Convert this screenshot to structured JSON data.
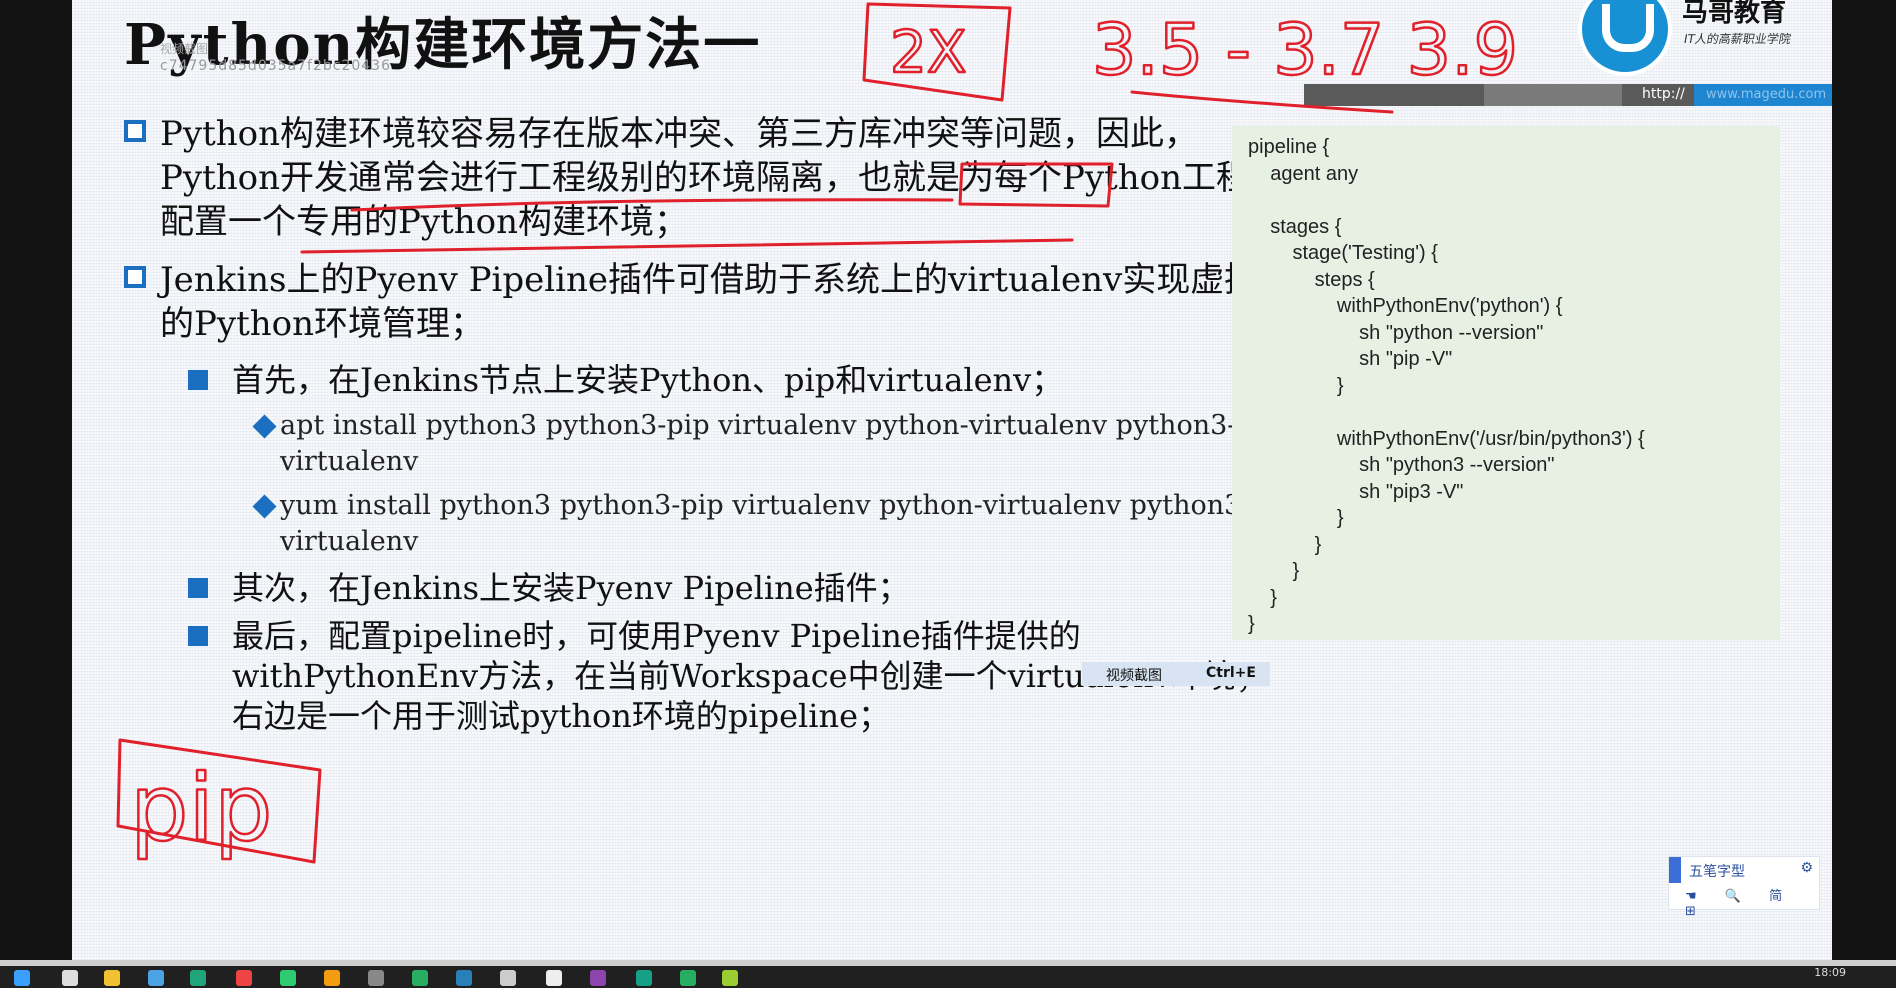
{
  "slide": {
    "title": "Python构建环境方法一",
    "title_overlay": "视频截图",
    "hash": "c74795d85d035a7f2bc20436",
    "logo_name": "马哥教育",
    "logo_tag": "IT人的高薪职业学院",
    "url_prefix": "http://",
    "url_text": "www.magedu.com",
    "bullets": [
      "Python构建环境较容易存在版本冲突、第三方库冲突等问题，因此，Python开发通常会进行工程级别的环境隔离，也就是为每个Python工程配置一个专用的Python构建环境；",
      "Jenkins上的Pyenv Pipeline插件可借助于系统上的virtualenv实现虚拟的Python环境管理；"
    ],
    "sub_first": "首先，在Jenkins节点上安装Python、pip和virtualenv；",
    "cmd_apt": "apt install python3 python3-pip virtualenv python-virtualenv python3-virtualenv",
    "cmd_yum": "yum install python3 python3-pip virtualenv python-virtualenv python3-virtualenv",
    "sub_second": "其次，在Jenkins上安装Pyenv Pipeline插件；",
    "sub_last": "最后，配置pipeline时，可使用Pyenv Pipeline插件提供的withPythonEnv方法，在当前Workspace中创建一个virtualenv环境；右边是一个用于测试python环境的pipeline；",
    "code": "pipeline {\n    agent any\n\n    stages {\n        stage('Testing') {\n            steps {\n                withPythonEnv('python') {\n                    sh \"python --version\"\n                    sh \"pip -V\"\n                }\n\n                withPythonEnv('/usr/bin/python3') {\n                    sh \"python3 --version\"\n                    sh \"pip3 -V\"\n                }\n            }\n        }\n    }\n}"
  },
  "annotations": {
    "top_x": "2X",
    "versions": "3.5 - 3.7   3.9",
    "pip": "pip"
  },
  "tooltip": {
    "label": "视频截图",
    "shortcut": "Ctrl+E"
  },
  "ime": {
    "label": "五笔字型",
    "row2": "☚ 🔍 简 ⊞"
  },
  "taskbar": {
    "time": "18:09"
  },
  "colors": {
    "accent_blue": "#1a6fc0",
    "annotation_red": "#e0202a",
    "code_bg": "#e6f1e4"
  }
}
